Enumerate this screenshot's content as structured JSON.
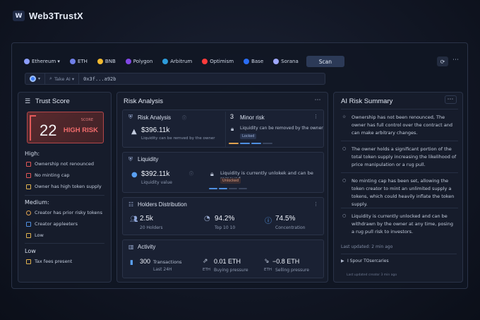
{
  "brand": {
    "logo": "W",
    "name": "Web3TrustX"
  },
  "chains": [
    {
      "label": "Ethereum ▾",
      "color": "#8c9eff"
    },
    {
      "label": "ETH",
      "color": "#6f7fe8"
    },
    {
      "label": "BNB",
      "color": "#f3ba2f"
    },
    {
      "label": "Polygon",
      "color": "#8247e5"
    },
    {
      "label": "Arbitrum",
      "color": "#2d9cdb"
    },
    {
      "label": "Optimism",
      "color": "#ff3b3b"
    },
    {
      "label": "Base",
      "color": "#2a6df5"
    },
    {
      "label": "Sorana",
      "color": "#9fa8ff"
    }
  ],
  "scan_label": "Scan",
  "search": {
    "filter_label": "Take AI ▾",
    "address": "0x3f...a92b"
  },
  "trust": {
    "title": "Trust Score",
    "score": "22",
    "score_caption": "SCORE",
    "risk_level": "HIGH RISK",
    "high": {
      "title": "High:",
      "items": [
        "Ownership not renounced",
        "No minting cap",
        "Owner has high token supply"
      ]
    },
    "medium": {
      "title": "Medium:",
      "items": [
        "Creator has prior risky tokens",
        "Creator appleeters",
        "Low"
      ]
    },
    "low": {
      "title": "Low",
      "items": [
        "Tax fees present"
      ]
    }
  },
  "risk": {
    "title": "Risk Analysis",
    "analysis": {
      "title": "Risk Analysis",
      "value": "$396.11k",
      "desc": "Liquidity can be remved by the owner",
      "count": "3",
      "count_label": "Minor risk",
      "lock_text": "Liquidity can be removed by the owner",
      "lock_tag": "Locked"
    },
    "liquidity": {
      "title": "Liquidity",
      "value": "$392.11k",
      "sub": "Liquidity value",
      "lock_text": "Liquidity is currently unlokek and can be removed",
      "lock_tag": "Unlocked"
    },
    "holders": {
      "title": "Holders Distribution",
      "count": "2.5k",
      "count_label": "20 Holders",
      "top": "94.2%",
      "top_label": "Top 10 10",
      "conc": "74.5%",
      "conc_label": "Concentration"
    },
    "activity": {
      "title": "Activity",
      "tx": "300",
      "tx_label1": "Transactions",
      "tx_label2": "Last 24H",
      "buy": "0.01 ETH",
      "buy_unit": "ETH",
      "buy_label": "Buying pressure",
      "sell": "−0.8 ETH",
      "sell_unit": "ETH",
      "sell_label": "Selling pressure"
    }
  },
  "ai": {
    "title": "AI Risk Summary",
    "items": [
      "Ownership has not been renounced, The owner has full control over the contract and can make arbitrary changes.",
      "The owner holds a significant portion of the total token supply increasing the likelihood of price manipulation or a rug pull.",
      "No minting cap has been set, allowing the token creator to mint an unlimited supply a tokens, which could heavily inflate the token supply.",
      "Liquidity is currently unlocked and can be withdrawn by the owner at any time, posing a rug pull risk to investors."
    ],
    "updated": "Last updated: 2 min ago",
    "source": "I Spour TOsercaries",
    "updated_small": "Last updated creator 3 min ago"
  }
}
